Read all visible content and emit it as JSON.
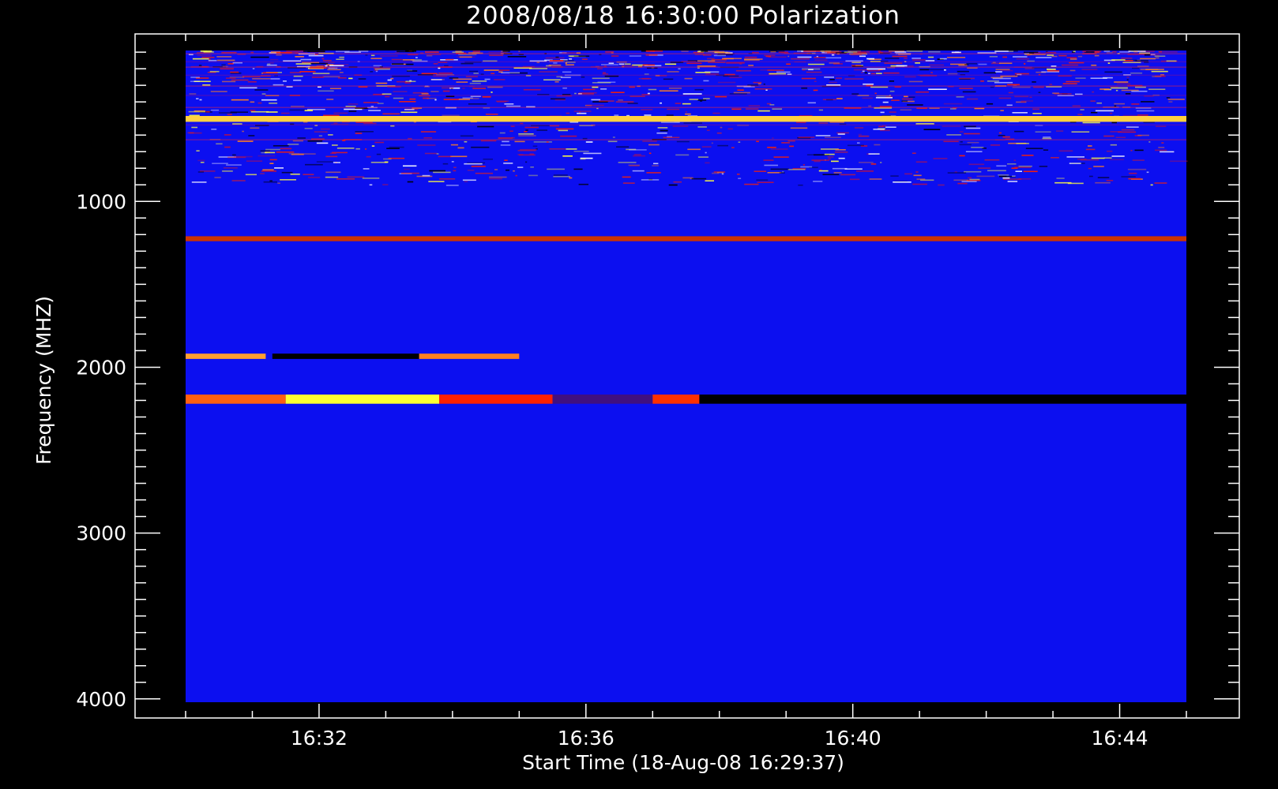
{
  "chart_data": {
    "type": "heatmap",
    "title": "2008/08/18 16:30:00 Polarization",
    "xlabel": "Start Time (18-Aug-08 16:29:37)",
    "ylabel": "Frequency (MHZ)",
    "x_ticks": [
      "16:32",
      "16:36",
      "16:40",
      "16:44"
    ],
    "y_ticks": [
      "1000",
      "2000",
      "3000",
      "4000"
    ],
    "x_tick_values_min": [
      2,
      6,
      10,
      14
    ],
    "xlim_min": [
      0,
      15
    ],
    "ylim_mhz": [
      90,
      4020
    ],
    "y_inverted": true,
    "colormap": [
      "#000000",
      "#0c0ff0",
      "#ff1a00",
      "#ffff30",
      "#ffffff"
    ],
    "background_color": "#0c0ff0",
    "features": [
      {
        "kind": "noise_band",
        "freq_mhz": [
          90,
          900
        ],
        "intensity": 0.7
      },
      {
        "kind": "band",
        "freq_mhz": [
          485,
          520
        ],
        "time_min": [
          0,
          15
        ],
        "color": "#ffd040"
      },
      {
        "kind": "band",
        "freq_mhz": [
          1210,
          1240
        ],
        "time_min": [
          0,
          15
        ],
        "color": "#cc3300"
      },
      {
        "kind": "band",
        "freq_mhz": [
          1918,
          1950
        ],
        "time_min": [
          0,
          1.2
        ],
        "color": "#ffa030"
      },
      {
        "kind": "band",
        "freq_mhz": [
          1918,
          1950
        ],
        "time_min": [
          1.3,
          3.5
        ],
        "color": "#000000"
      },
      {
        "kind": "band",
        "freq_mhz": [
          1918,
          1950
        ],
        "time_min": [
          3.5,
          5.0
        ],
        "color": "#ff8020"
      },
      {
        "kind": "band",
        "freq_mhz": [
          2165,
          2220
        ],
        "time_min": [
          0,
          1.5
        ],
        "color": "#ff6010"
      },
      {
        "kind": "band",
        "freq_mhz": [
          2165,
          2220
        ],
        "time_min": [
          1.5,
          3.8
        ],
        "color": "#ffff30"
      },
      {
        "kind": "band",
        "freq_mhz": [
          2165,
          2220
        ],
        "time_min": [
          3.8,
          5.5
        ],
        "color": "#ff2000"
      },
      {
        "kind": "band",
        "freq_mhz": [
          2165,
          2220
        ],
        "time_min": [
          5.5,
          7.0
        ],
        "color": "#401080"
      },
      {
        "kind": "band",
        "freq_mhz": [
          2165,
          2220
        ],
        "time_min": [
          7.0,
          7.7
        ],
        "color": "#ff3000"
      },
      {
        "kind": "band",
        "freq_mhz": [
          2165,
          2220
        ],
        "time_min": [
          7.7,
          15
        ],
        "color": "#000000"
      }
    ]
  }
}
